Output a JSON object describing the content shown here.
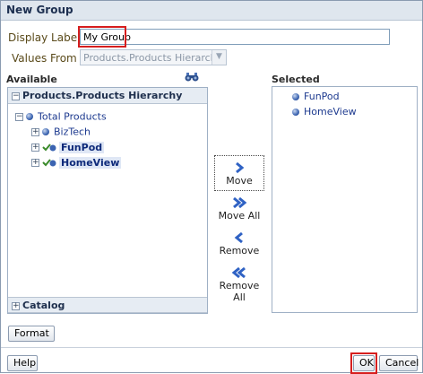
{
  "dialog": {
    "title": "New Group"
  },
  "display_label": {
    "label": "Display Label",
    "value": "My Group"
  },
  "values_from": {
    "label": "Values From",
    "selected": "Products.Products Hierarchy"
  },
  "available": {
    "heading": "Available",
    "panel_title": "Products.Products Hierarchy",
    "tree": [
      {
        "label": "Total Products",
        "expand": "−"
      },
      {
        "label": "BizTech",
        "expand": "+"
      },
      {
        "label": "FunPod",
        "expand": "+"
      },
      {
        "label": "HomeView",
        "expand": "+"
      }
    ],
    "catalog_title": "Catalog"
  },
  "shuttle": {
    "move": "Move",
    "move_all": "Move All",
    "remove": "Remove",
    "remove_all": "Remove All"
  },
  "selected": {
    "heading": "Selected",
    "items": [
      "FunPod",
      "HomeView"
    ]
  },
  "buttons": {
    "format": "Format",
    "help": "Help",
    "ok": "OK",
    "cancel": "Cancel"
  },
  "colors": {
    "accent_highlight": "#d61e1e",
    "header_bg": "#dfe6ee",
    "tree_text": "#1d3a8f"
  }
}
